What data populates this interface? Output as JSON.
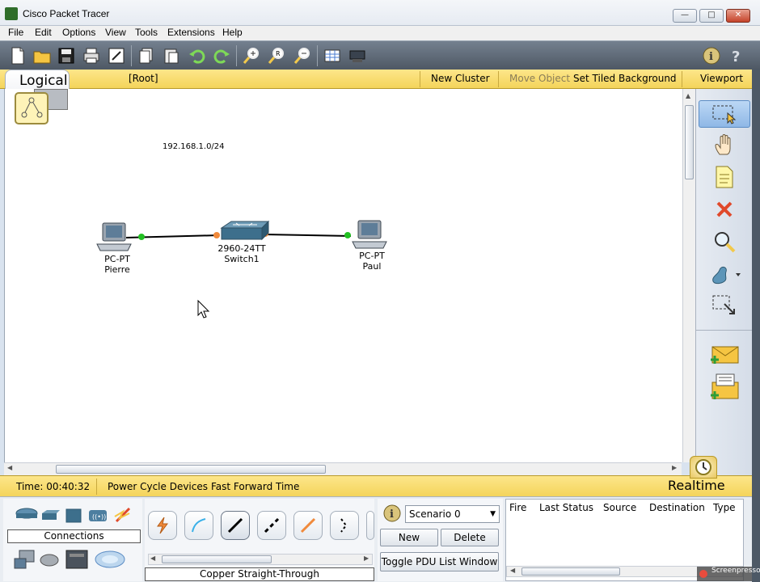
{
  "window": {
    "title": "Cisco Packet Tracer",
    "minimize_icon": "minimize-icon",
    "maximize_icon": "maximize-icon",
    "close_icon": "close-icon"
  },
  "menu": [
    "File",
    "Edit",
    "Options",
    "View",
    "Tools",
    "Extensions",
    "Help"
  ],
  "workspace_header": {
    "tab_label": "Logical",
    "root_label": "[Root]",
    "new_cluster": "New Cluster",
    "move_object": "Move Object",
    "set_tiled_background": "Set Tiled Background",
    "viewport": "Viewport"
  },
  "canvas": {
    "network_note": "192.168.1.0/24",
    "devices": [
      {
        "type": "PC-PT",
        "name": "Pierre"
      },
      {
        "type": "2960-24TT",
        "name": "Switch1"
      },
      {
        "type": "PC-PT",
        "name": "Paul"
      }
    ],
    "link_colors": {
      "up": "#22c022",
      "blocking": "#f08a3c"
    }
  },
  "status_bar": {
    "time": "Time: 00:40:32",
    "power_cycle": "Power Cycle Devices",
    "fast_forward": "Fast Forward Time",
    "mode": "Realtime"
  },
  "bottom": {
    "category_label": "Connections",
    "cable_label": "Copper Straight-Through",
    "scenario_selected": "Scenario 0",
    "new_button": "New",
    "delete_button": "Delete",
    "toggle_pdu": "Toggle PDU List Window",
    "pdu_columns": [
      "Fire",
      "Last Status",
      "Source",
      "Destination",
      "Type"
    ]
  },
  "watermark": "Screenpresso"
}
